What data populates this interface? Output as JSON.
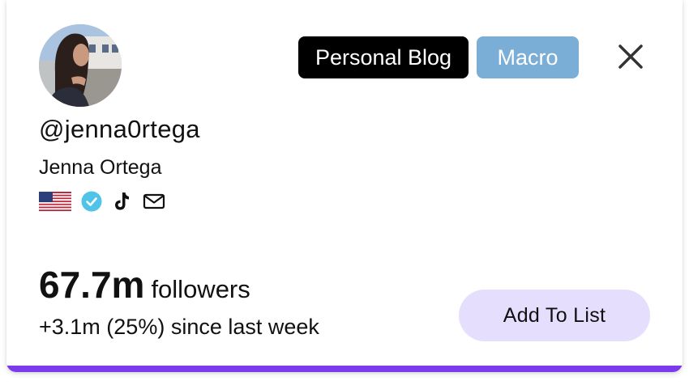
{
  "profile": {
    "handle": "@jenna0rtega",
    "full_name": "Jenna Ortega",
    "avatar": "profile-photo"
  },
  "tags": {
    "category": "Personal Blog",
    "tier": "Macro"
  },
  "badges": {
    "country": "us-flag-icon",
    "verified": "verified-check-icon",
    "platform": "tiktok-icon",
    "contact": "mail-icon"
  },
  "stats": {
    "followers_count": "67.7m",
    "followers_unit": "followers",
    "growth_text": "+3.1m (25%) since last week"
  },
  "actions": {
    "add_to_list": "Add To List",
    "close": "close-icon"
  },
  "colors": {
    "accent_bar": "#7c3aed",
    "tag_blog_bg": "#000000",
    "tag_macro_bg": "#7aaed6",
    "button_bg": "#e6defd",
    "verified": "#4fc3e8"
  }
}
